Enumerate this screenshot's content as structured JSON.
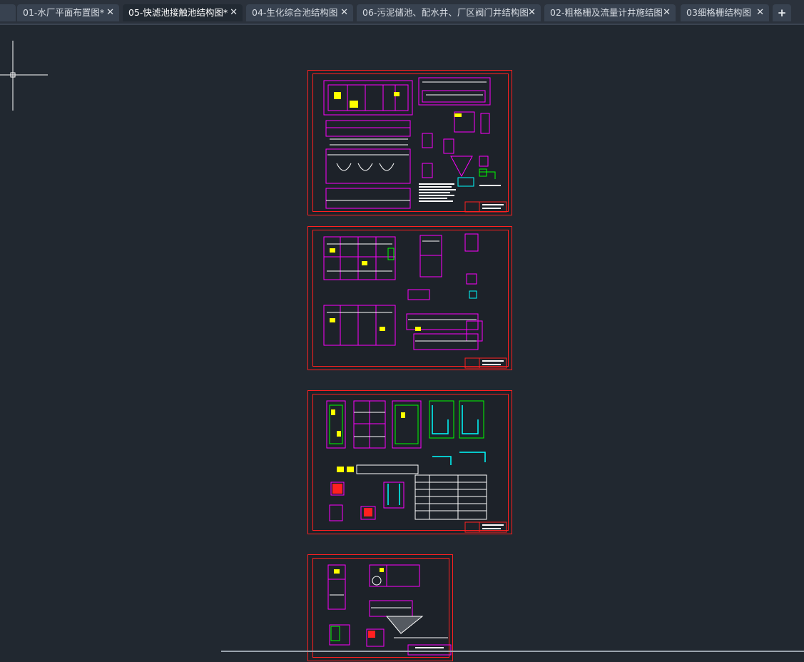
{
  "tabs": [
    {
      "label": "01-水厂平面布置图*",
      "close": "✕",
      "active": false
    },
    {
      "label": "05-快滤池接触池结构图*",
      "close": "✕",
      "active": true
    },
    {
      "label": "04-生化综合池结构图",
      "close": "✕",
      "active": false
    },
    {
      "label": "06-污泥储池、配水井、厂区阀门井结构图",
      "close": "✕",
      "active": false
    },
    {
      "label": "02-粗格栅及流量计井施结图",
      "close": "✕",
      "active": false
    },
    {
      "label": "03细格栅结构图",
      "close": "✕",
      "active": false
    }
  ],
  "new_tab_label": "+",
  "colors": {
    "background": "#212830",
    "sheet_border": "#ff2020",
    "magenta": "#ff00ff",
    "white": "#ffffff",
    "yellow": "#ffff00",
    "cyan": "#00ffff",
    "green": "#00ff00"
  },
  "sheets": [
    {
      "name": "sheet-1"
    },
    {
      "name": "sheet-2"
    },
    {
      "name": "sheet-3"
    },
    {
      "name": "sheet-4"
    }
  ]
}
